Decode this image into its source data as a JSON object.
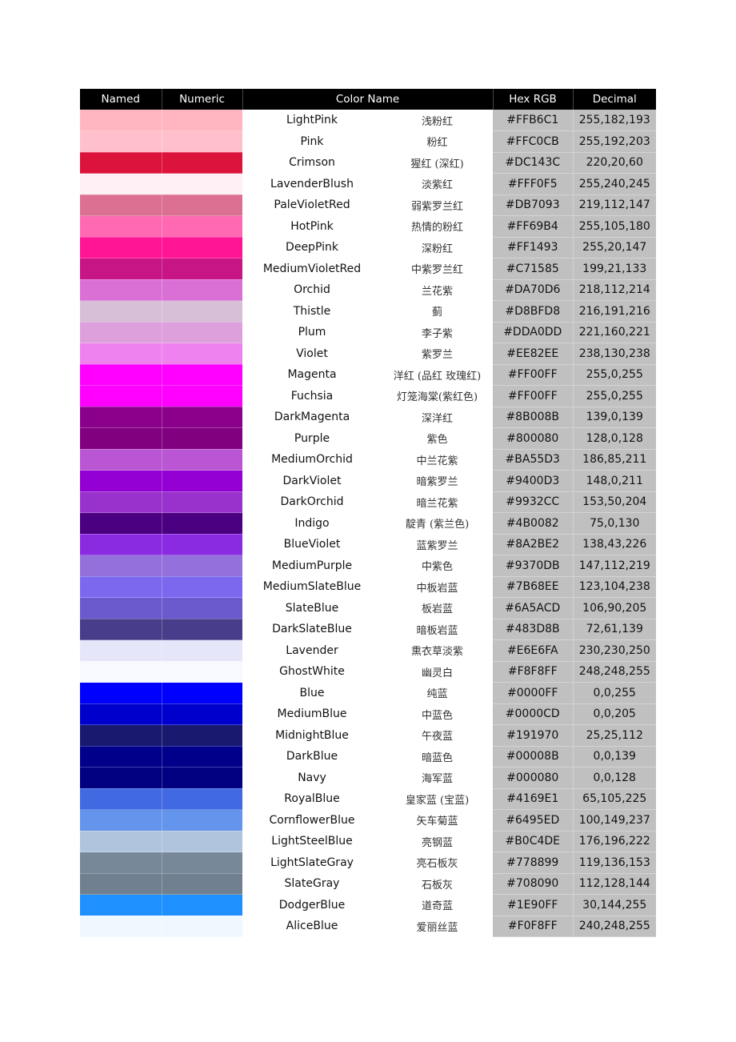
{
  "headers": {
    "named": "Named",
    "numeric": "Numeric",
    "color_name": "Color Name",
    "hex": "Hex RGB",
    "decimal": "Decimal"
  },
  "rows": [
    {
      "en": "LightPink",
      "zh": "浅粉红",
      "hex": "#FFB6C1",
      "dec": "255,182,193"
    },
    {
      "en": "Pink",
      "zh": "粉红",
      "hex": "#FFC0CB",
      "dec": "255,192,203"
    },
    {
      "en": "Crimson",
      "zh": "猩红 (深红)",
      "hex": "#DC143C",
      "dec": "220,20,60"
    },
    {
      "en": "LavenderBlush",
      "zh": "淡紫红",
      "hex": "#FFF0F5",
      "dec": "255,240,245"
    },
    {
      "en": "PaleVioletRed",
      "zh": "弱紫罗兰红",
      "hex": "#DB7093",
      "dec": "219,112,147"
    },
    {
      "en": "HotPink",
      "zh": "热情的粉红",
      "hex": "#FF69B4",
      "dec": "255,105,180"
    },
    {
      "en": "DeepPink",
      "zh": "深粉红",
      "hex": "#FF1493",
      "dec": "255,20,147"
    },
    {
      "en": "MediumVioletRed",
      "zh": "中紫罗兰红",
      "hex": "#C71585",
      "dec": "199,21,133"
    },
    {
      "en": "Orchid",
      "zh": "兰花紫",
      "hex": "#DA70D6",
      "dec": "218,112,214"
    },
    {
      "en": "Thistle",
      "zh": "蓟",
      "hex": "#D8BFD8",
      "dec": "216,191,216"
    },
    {
      "en": "Plum",
      "zh": "李子紫",
      "hex": "#DDA0DD",
      "dec": "221,160,221"
    },
    {
      "en": "Violet",
      "zh": "紫罗兰",
      "hex": "#EE82EE",
      "dec": "238,130,238"
    },
    {
      "en": "Magenta",
      "zh": "洋红 (品红 玫瑰红)",
      "hex": "#FF00FF",
      "dec": "255,0,255"
    },
    {
      "en": "Fuchsia",
      "zh": "灯笼海棠(紫红色)",
      "hex": "#FF00FF",
      "dec": "255,0,255"
    },
    {
      "en": "DarkMagenta",
      "zh": "深洋红",
      "hex": "#8B008B",
      "dec": "139,0,139"
    },
    {
      "en": "Purple",
      "zh": "紫色",
      "hex": "#800080",
      "dec": "128,0,128"
    },
    {
      "en": "MediumOrchid",
      "zh": "中兰花紫",
      "hex": "#BA55D3",
      "dec": "186,85,211"
    },
    {
      "en": "DarkViolet",
      "zh": "暗紫罗兰",
      "hex": "#9400D3",
      "dec": "148,0,211"
    },
    {
      "en": "DarkOrchid",
      "zh": "暗兰花紫",
      "hex": "#9932CC",
      "dec": "153,50,204"
    },
    {
      "en": "Indigo",
      "zh": "靛青 (紫兰色)",
      "hex": "#4B0082",
      "dec": "75,0,130"
    },
    {
      "en": "BlueViolet",
      "zh": "蓝紫罗兰",
      "hex": "#8A2BE2",
      "dec": "138,43,226"
    },
    {
      "en": "MediumPurple",
      "zh": "中紫色",
      "hex": "#9370DB",
      "dec": "147,112,219"
    },
    {
      "en": "MediumSlateBlue",
      "zh": "中板岩蓝",
      "hex": "#7B68EE",
      "dec": "123,104,238"
    },
    {
      "en": "SlateBlue",
      "zh": "板岩蓝",
      "hex": "#6A5ACD",
      "dec": "106,90,205"
    },
    {
      "en": "DarkSlateBlue",
      "zh": "暗板岩蓝",
      "hex": "#483D8B",
      "dec": "72,61,139"
    },
    {
      "en": "Lavender",
      "zh": "熏衣草淡紫",
      "hex": "#E6E6FA",
      "dec": "230,230,250"
    },
    {
      "en": "GhostWhite",
      "zh": "幽灵白",
      "hex": "#F8F8FF",
      "dec": "248,248,255"
    },
    {
      "en": "Blue",
      "zh": "纯蓝",
      "hex": "#0000FF",
      "dec": "0,0,255"
    },
    {
      "en": "MediumBlue",
      "zh": "中蓝色",
      "hex": "#0000CD",
      "dec": "0,0,205"
    },
    {
      "en": "MidnightBlue",
      "zh": "午夜蓝",
      "hex": "#191970",
      "dec": "25,25,112"
    },
    {
      "en": "DarkBlue",
      "zh": "暗蓝色",
      "hex": "#00008B",
      "dec": "0,0,139"
    },
    {
      "en": "Navy",
      "zh": "海军蓝",
      "hex": "#000080",
      "dec": "0,0,128"
    },
    {
      "en": "RoyalBlue",
      "zh": "皇家蓝 (宝蓝)",
      "hex": "#4169E1",
      "dec": "65,105,225"
    },
    {
      "en": "CornflowerBlue",
      "zh": "矢车菊蓝",
      "hex": "#6495ED",
      "dec": "100,149,237"
    },
    {
      "en": "LightSteelBlue",
      "zh": "亮钢蓝",
      "hex": "#B0C4DE",
      "dec": "176,196,222"
    },
    {
      "en": "LightSlateGray",
      "zh": "亮石板灰",
      "hex": "#778899",
      "dec": "119,136,153"
    },
    {
      "en": "SlateGray",
      "zh": "石板灰",
      "hex": "#708090",
      "dec": "112,128,144"
    },
    {
      "en": "DodgerBlue",
      "zh": "道奇蓝",
      "hex": "#1E90FF",
      "dec": "30,144,255"
    },
    {
      "en": "AliceBlue",
      "zh": "爱丽丝蓝",
      "hex": "#F0F8FF",
      "dec": "240,248,255"
    }
  ]
}
